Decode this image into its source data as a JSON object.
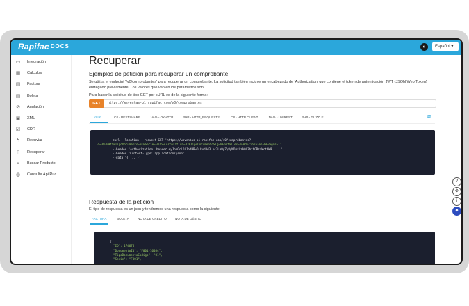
{
  "app": {
    "logo": "Rapifac",
    "logo_suffix": "DOCS",
    "language": "Español ▾",
    "theme_icon": "contrast-icon"
  },
  "sidebar": {
    "items": [
      {
        "label": "Integración",
        "icon": "▭"
      },
      {
        "label": "Cálculos",
        "icon": "▦"
      },
      {
        "label": "Factura",
        "icon": "▤"
      },
      {
        "label": "Boleta",
        "icon": "▤"
      },
      {
        "label": "Anulación",
        "icon": "⊘"
      },
      {
        "label": "XML",
        "icon": "▣"
      },
      {
        "label": "CDR",
        "icon": "☑"
      },
      {
        "label": "Reenviar",
        "icon": "↰"
      },
      {
        "label": "Recuperar",
        "icon": "▯"
      },
      {
        "label": "Buscar Producto",
        "icon": "⌕"
      },
      {
        "label": "Consulta Api Ruc",
        "icon": "◍"
      }
    ]
  },
  "main": {
    "title": "Recuperar",
    "section1_title": "Ejemplos de petición para recuperar un comprobante",
    "section1_desc": "Se utiliza el endpoint '/v0/comprobantes' para recuperar un comprobante. La solicitud también incluye un encabezado de 'Authorization' que contiene el token de autenticación JWT (JSON Web Token) entregado previamente. Los valores que van en los parámetros son",
    "section1_desc2": "Para hacer la solicitud de tipo GET por cURL es de la siguiente forma:",
    "method": "GET",
    "url": "https://wsventas-p1.rapifac.com/v0/comprobantes",
    "tabs": [
      "cURL",
      "C# - RESTSHARP",
      "JAVA - OKHTTP",
      "PHP - HTTP_REQUEST2",
      "C# - HTTP CLIENT",
      "JAVA - UNIREST",
      "PHP - GUZZLE"
    ],
    "code_lines": [
      "curl --location --request GET 'https://wsventas-p1.rapifac.com/v0/comprobantes?",
      "Id=39309ff&TipoDocumento=01&Serie=F026&Correlativo=32&TipoDocumentoSlg=0&Detalles=1&Adicionales=0&Pagos=1'",
      "--header 'Authorization: bearer eyJhbGciOiJodHRwOi8vd3d3Lnc3Lm9yZy8yMDAxLzA0L3htbGRzaWctbW9.....'",
      "--header 'Content-Type: application/json'",
      "--data '{ ... }'"
    ],
    "section2_title": "Respuesta de la petición",
    "section2_desc": "El tipo de respuesta es un json y tendremos una respuesta como la siguiente:",
    "tabs2": [
      "FACTURA",
      "BOLETA",
      "NOTA DE CRÉDITO",
      "NOTA DE DÉBITO"
    ],
    "response_lines": [
      "{",
      "  \"ID\": 174676,",
      "  \"DocumentoId\": \"F001-16464\",",
      "  \"TipoDocumentoCodigo\": \"01\",",
      "  \"Serie\": \"F001\","
    ]
  },
  "floating": [
    "help-icon",
    "settings-icon",
    "info-icon",
    "chat-icon"
  ]
}
